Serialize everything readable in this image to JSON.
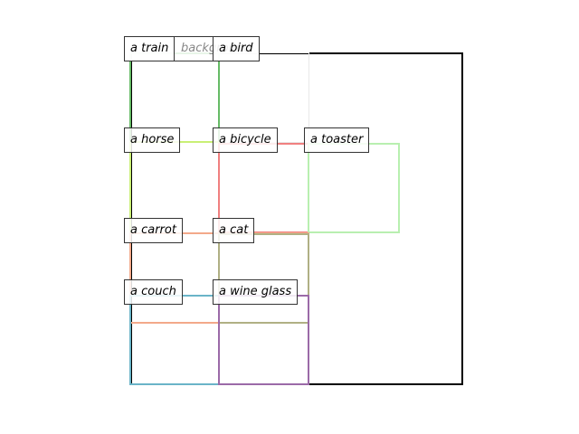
{
  "boxes": [
    {
      "label": "a train",
      "color": "#66bb66"
    },
    {
      "label": "a bird",
      "color": "#66bb66"
    },
    {
      "label": "a horse",
      "color": "#b9ef55"
    },
    {
      "label": "a bicycle",
      "color": "#f08080"
    },
    {
      "label": "a toaster",
      "color": "#a8eba0"
    },
    {
      "label": "a carrot",
      "color": "#f3a98a"
    },
    {
      "label": "a cat",
      "color": "#b0b084"
    },
    {
      "label": "a couch",
      "color": "#6ab4c8"
    },
    {
      "label": "a wine glass",
      "color": "#9b6aa8"
    }
  ],
  "obscured_label_fragment": "background",
  "outer_frame_color": "#000000",
  "faint_frame_color": "#e8e8e8"
}
